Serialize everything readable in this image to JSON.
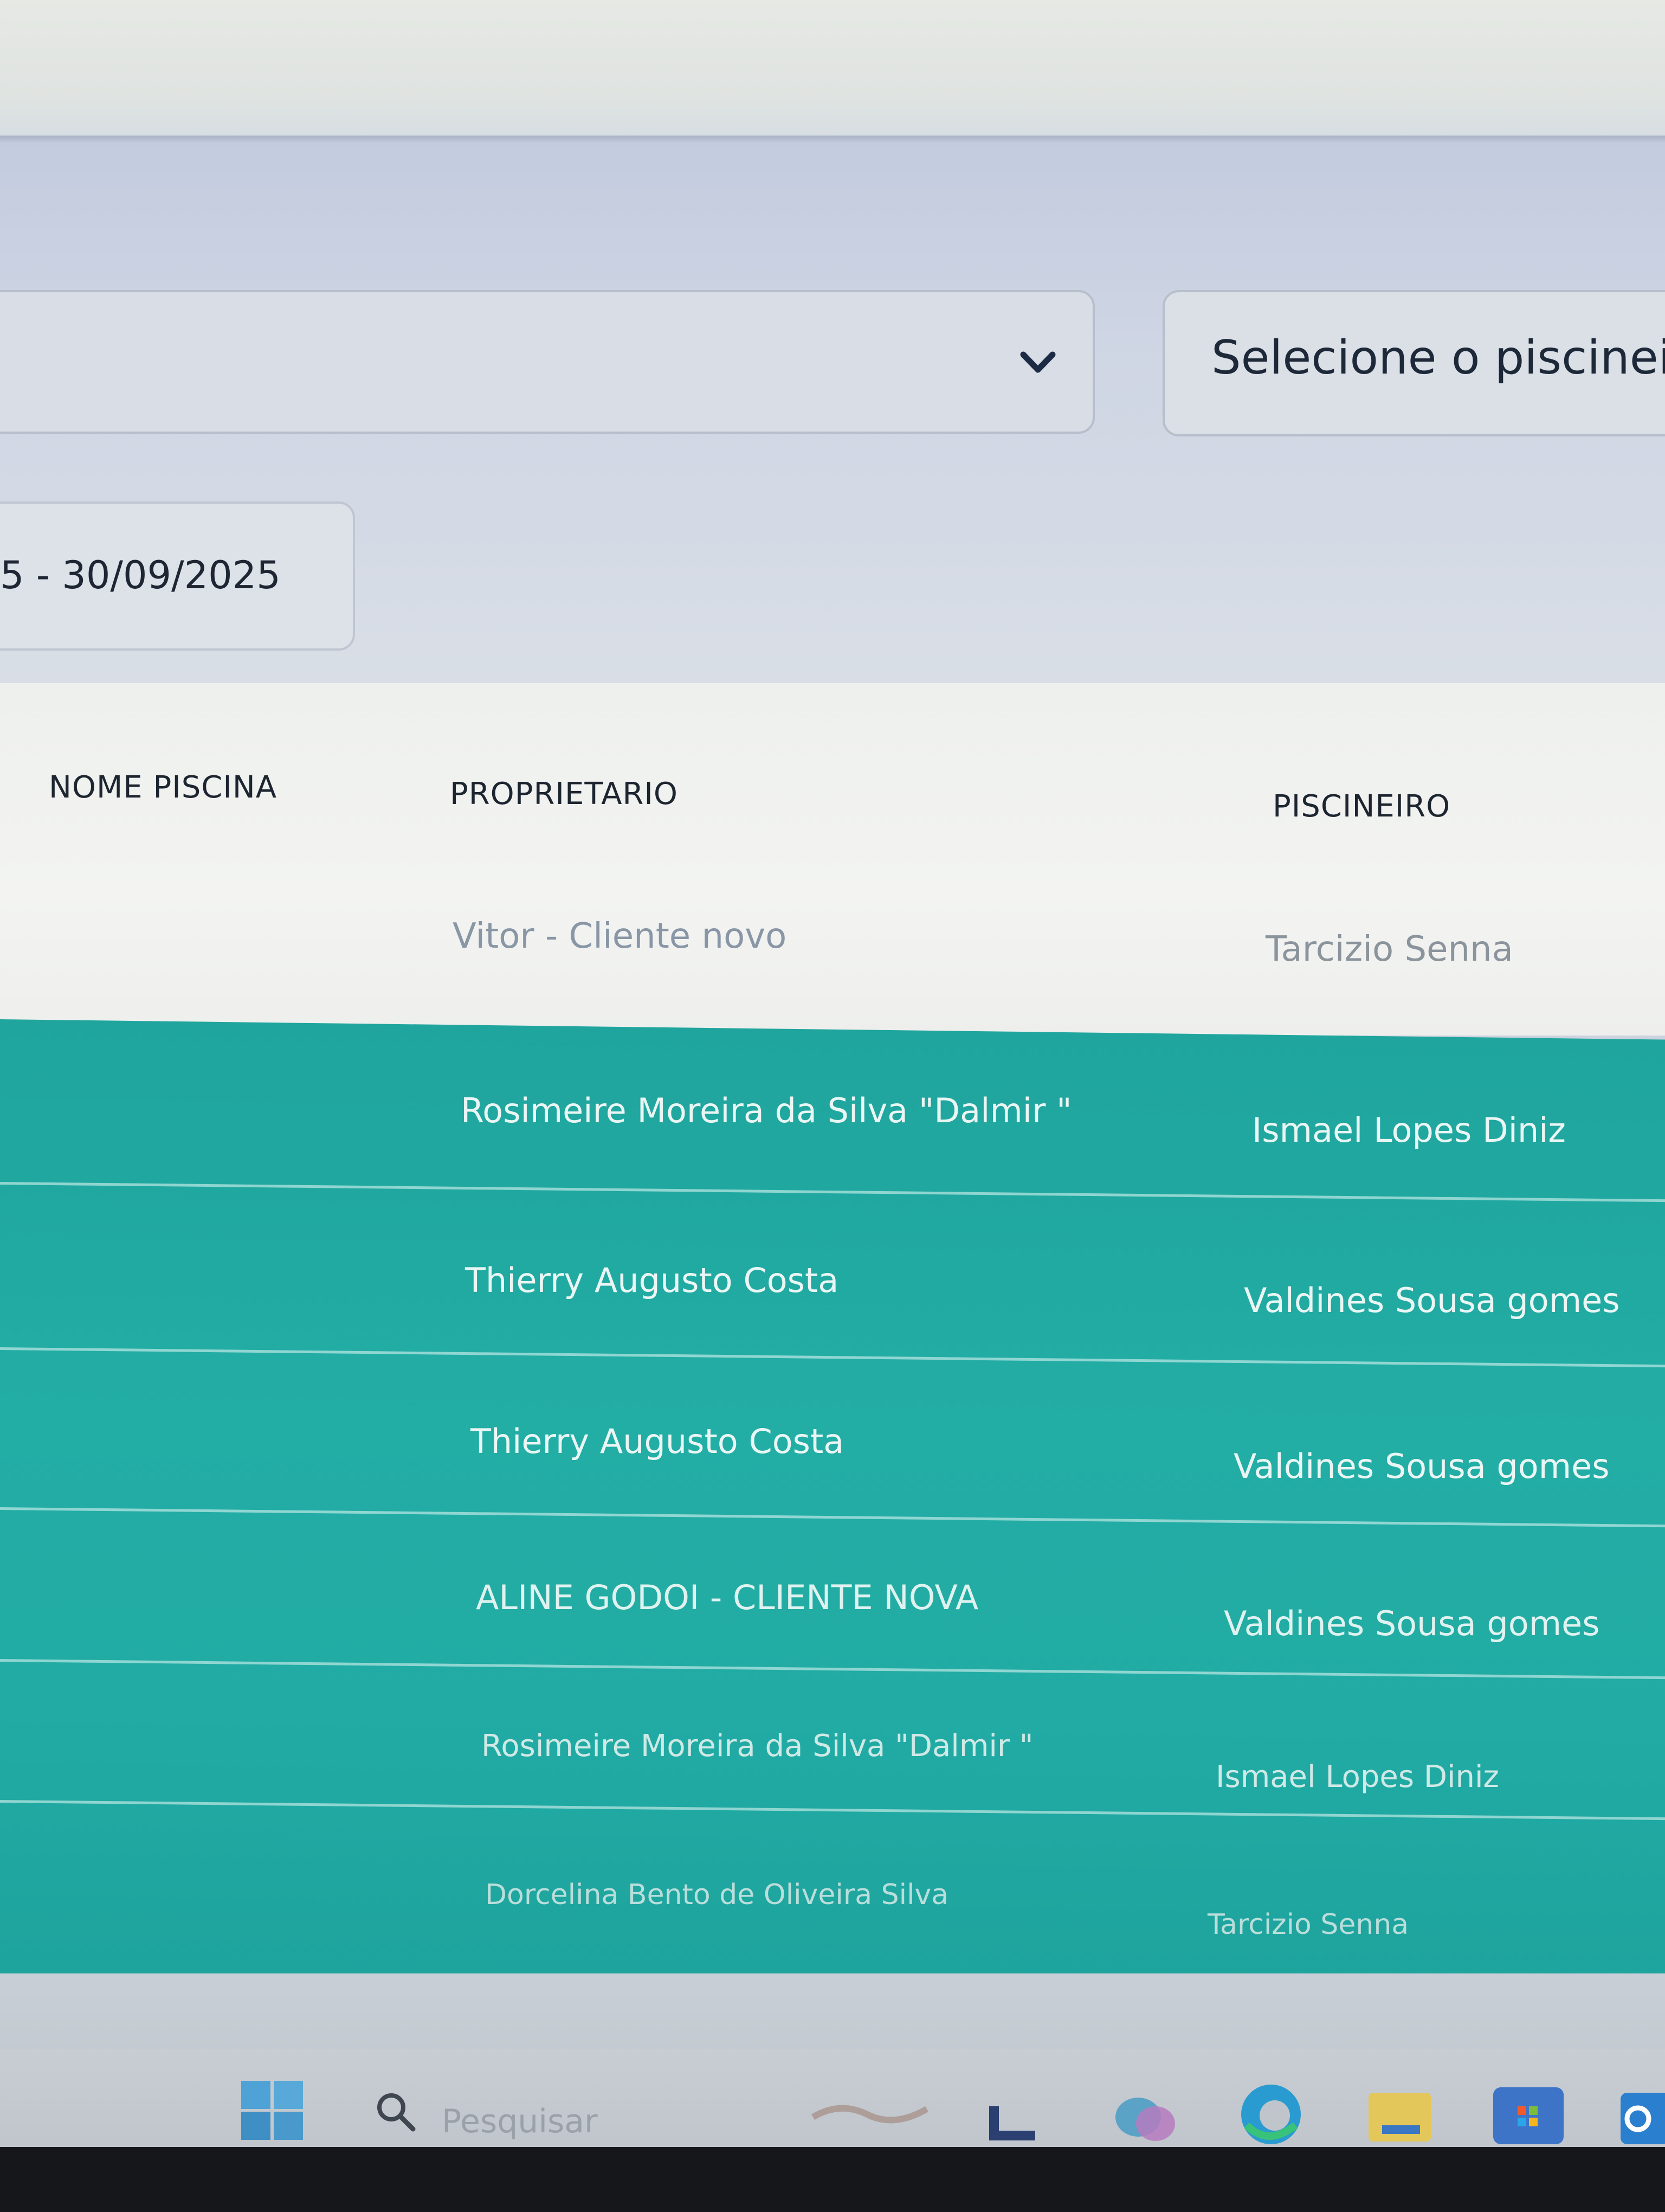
{
  "filters": {
    "piscineiro_placeholder": "Selecione o piscineiro",
    "date_range": "5 - 30/09/2025"
  },
  "table": {
    "headers": [
      "NOME PISCINA",
      "PROPRIETARIO",
      "PISCINEIRO"
    ],
    "rows": [
      {
        "nome_piscina": "",
        "proprietario": "Vitor - Cliente novo",
        "piscineiro": "Tarcizio Senna",
        "highlight": false
      },
      {
        "nome_piscina": "",
        "proprietario": "Rosimeire Moreira da Silva \"Dalmir \"",
        "piscineiro": "Ismael Lopes Diniz",
        "highlight": true
      },
      {
        "nome_piscina": "",
        "proprietario": "Thierry Augusto Costa",
        "piscineiro": "Valdines Sousa gomes",
        "highlight": true
      },
      {
        "nome_piscina": "",
        "proprietario": "Thierry Augusto Costa",
        "piscineiro": "Valdines Sousa gomes",
        "highlight": true
      },
      {
        "nome_piscina": "",
        "proprietario": "ALINE GODOI - CLIENTE NOVA",
        "piscineiro": "Valdines Sousa gomes",
        "highlight": true
      },
      {
        "nome_piscina": "",
        "proprietario": "Rosimeire Moreira da Silva \"Dalmir \"",
        "piscineiro": "Ismael Lopes Diniz",
        "highlight": true
      },
      {
        "nome_piscina": "",
        "proprietario": "Dorcelina Bento de Oliveira Silva",
        "piscineiro": "Tarcizio Senna",
        "highlight": true
      }
    ]
  },
  "taskbar": {
    "search_placeholder": "Pesquisar"
  },
  "colors": {
    "highlight_row": "#21aba4",
    "header_bg": "#c9d0df"
  },
  "icons": [
    "chevron-down-icon",
    "windows-start-icon",
    "search-icon",
    "edge-icon",
    "file-explorer-icon",
    "store-icon",
    "outlook-icon"
  ]
}
